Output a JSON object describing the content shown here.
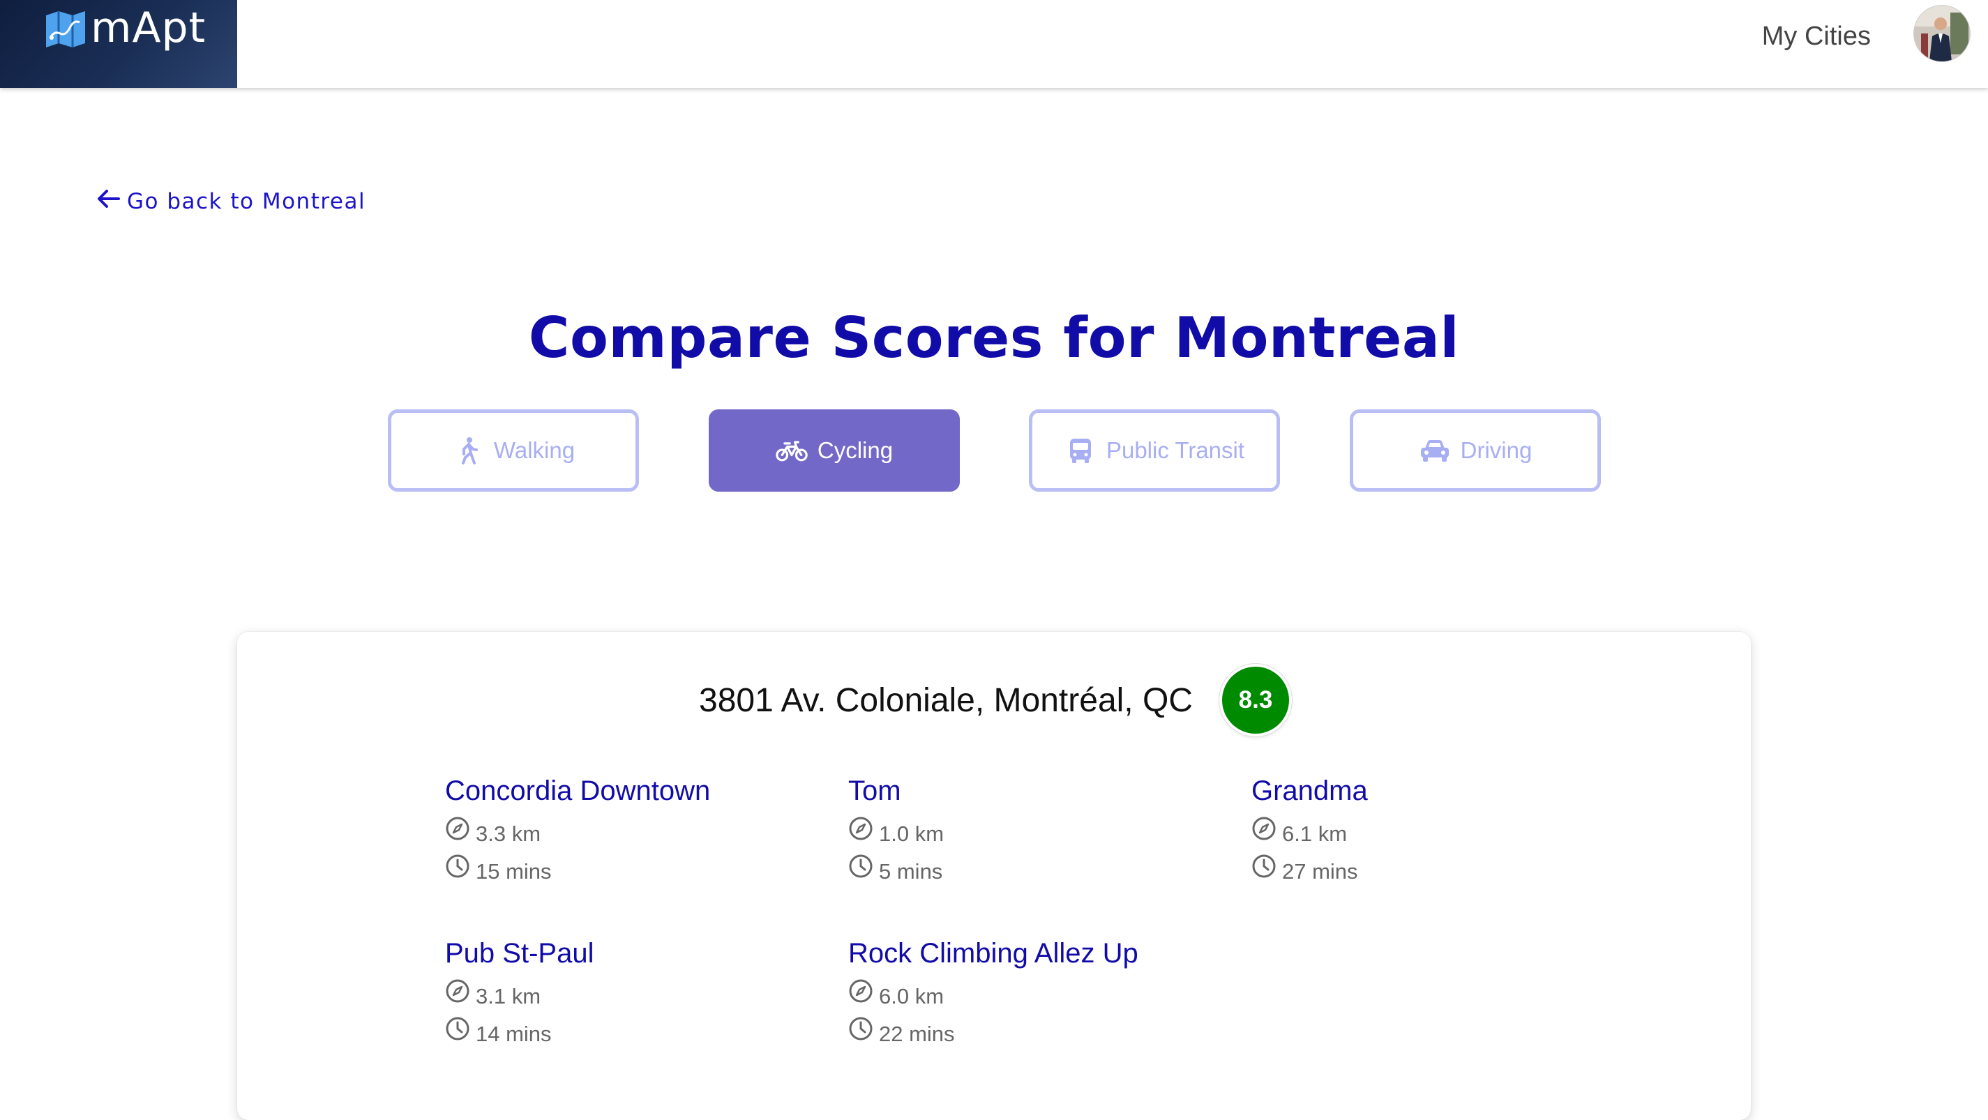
{
  "header": {
    "brand_name": "mApt",
    "nav_my_cities": "My Cities"
  },
  "back_link": {
    "label": "Go back to Montreal"
  },
  "page_title": "Compare Scores for Montreal",
  "modes": [
    {
      "label": "Walking",
      "icon": "walking-icon",
      "active": false
    },
    {
      "label": "Cycling",
      "icon": "bicycle-icon",
      "active": true
    },
    {
      "label": "Public Transit",
      "icon": "bus-icon",
      "active": false
    },
    {
      "label": "Driving",
      "icon": "car-icon",
      "active": false
    }
  ],
  "card": {
    "address": "3801 Av. Coloniale, Montréal, QC",
    "score": "8.3",
    "score_color": "#008a00",
    "destinations": [
      {
        "name": "Concordia Downtown",
        "distance": "3.3 km",
        "time": "15 mins"
      },
      {
        "name": "Tom",
        "distance": "1.0 km",
        "time": "5 mins"
      },
      {
        "name": "Grandma",
        "distance": "6.1 km",
        "time": "27 mins"
      },
      {
        "name": "Pub St-Paul",
        "distance": "3.1 km",
        "time": "14 mins"
      },
      {
        "name": "Rock Climbing Allez Up",
        "distance": "6.0 km",
        "time": "22 mins"
      }
    ]
  },
  "colors": {
    "primary": "#110ba8",
    "active_tab": "#7268c8",
    "inactive_tab": "#b9bef5",
    "score_green": "#008a00"
  }
}
